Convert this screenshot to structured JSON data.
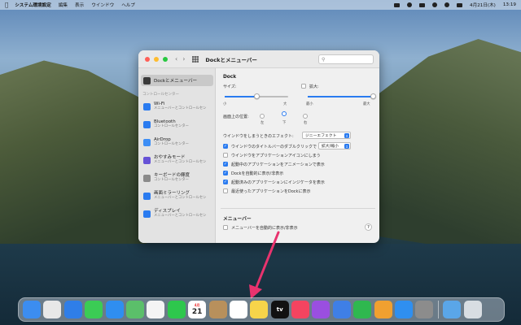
{
  "menubar": {
    "app_name": "システム環境設定",
    "menus": [
      "編集",
      "表示",
      "ウインドウ",
      "ヘルプ"
    ],
    "date": "4月21日(木)",
    "time": "13:19"
  },
  "window": {
    "title": "Dockとメニューバー",
    "search_placeholder": "検索"
  },
  "sidebar": {
    "selected": "Dockとメニューバー",
    "section": "コントロールセンター",
    "items": [
      {
        "name": "Wi-Fi",
        "sub": "メニューバーとコントロールセン"
      },
      {
        "name": "Bluetooth",
        "sub": "コントロールセンター"
      },
      {
        "name": "AirDrop",
        "sub": "コントロールセンター"
      },
      {
        "name": "おやすみモード",
        "sub": "メニューバーとコントロールセン"
      },
      {
        "name": "キーボードの輝度",
        "sub": "コントロールセンター"
      },
      {
        "name": "画面ミラーリング",
        "sub": "メニューバーとコントロールセン"
      },
      {
        "name": "ディスプレイ",
        "sub": "メニューバーとコントロールセン"
      }
    ]
  },
  "dock_section": {
    "title": "Dock",
    "size_label": "サイズ:",
    "size_min": "小",
    "size_max": "大",
    "size_value": 0.5,
    "mag_label": "拡大:",
    "mag_min": "最小",
    "mag_max": "最大",
    "mag_value": 1.0,
    "position_label": "画面上の位置:",
    "position_options": [
      "左",
      "下",
      "右"
    ],
    "position_selected": "下",
    "minimize_effect_label": "ウインドウをしまうときのエフェクト:",
    "minimize_effect_value": "ジニーエフェクト",
    "double_click_label": "ウインドウのタイトルバーのダブルクリックで",
    "double_click_value": "拡大/縮小",
    "options": [
      {
        "label": "ウインドウをアプリケーションアイコンにしまう",
        "checked": false
      },
      {
        "label": "起動中のアプリケーションをアニメーションで表示",
        "checked": true
      },
      {
        "label": "Dockを自動的に表示/非表示",
        "checked": true
      },
      {
        "label": "起動済みのアプリケーションにインジケータを表示",
        "checked": true
      },
      {
        "label": "最近使ったアプリケーションをDockに表示",
        "checked": false
      }
    ]
  },
  "menubar_section": {
    "title": "メニューバー",
    "autohide_label": "メニューバーを自動的に表示/非表示",
    "autohide_checked": false,
    "help_label": "?"
  },
  "dock": {
    "icons": [
      {
        "name": "finder",
        "color": "#3c8df0"
      },
      {
        "name": "launchpad",
        "color": "#e8e8e8"
      },
      {
        "name": "safari",
        "color": "#2f7ee8"
      },
      {
        "name": "messages",
        "color": "#3bcc55"
      },
      {
        "name": "mail",
        "color": "#2f8ef0"
      },
      {
        "name": "maps",
        "color": "#5bbf6a"
      },
      {
        "name": "photos",
        "color": "#f4f4f4"
      },
      {
        "name": "facetime",
        "color": "#2ec74d"
      },
      {
        "name": "calendar",
        "color": "#ffffff"
      },
      {
        "name": "contacts",
        "color": "#b8905c"
      },
      {
        "name": "reminders",
        "color": "#ffffff"
      },
      {
        "name": "notes",
        "color": "#f7d44a"
      },
      {
        "name": "tv",
        "color": "#111111"
      },
      {
        "name": "music",
        "color": "#f44460"
      },
      {
        "name": "podcasts",
        "color": "#9a4fe0"
      },
      {
        "name": "keynote",
        "color": "#3f7fe6"
      },
      {
        "name": "numbers",
        "color": "#2fb84f"
      },
      {
        "name": "pages",
        "color": "#f0a030"
      },
      {
        "name": "app-store",
        "color": "#2f8ff0"
      },
      {
        "name": "system-preferences",
        "color": "#8c8c8c"
      },
      {
        "name": "downloads-folder",
        "color": "#5aa6e8"
      },
      {
        "name": "trash",
        "color": "#d8dde2"
      }
    ],
    "calendar_month": "4月",
    "calendar_day": "21",
    "tv_label": "tv"
  },
  "colors": {
    "accent": "#2a7bf0",
    "pointer": "#e8336e"
  }
}
